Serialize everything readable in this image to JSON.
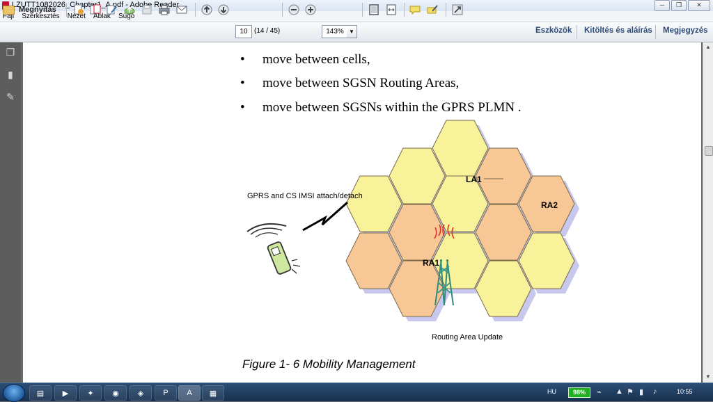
{
  "window": {
    "title": "LZUTT1082026_Chapter1_A.pdf - Adobe Reader",
    "controls": [
      "minimize",
      "restore",
      "close"
    ]
  },
  "menubar": {
    "items": [
      "Fájl",
      "Szerkesztés",
      "Nézet",
      "Ablak",
      "Súgó"
    ]
  },
  "toolbar": {
    "open_label": "Megnyitás",
    "page_number": "10",
    "page_count": "(14 / 45)",
    "zoom": "143%",
    "right_links": [
      "Eszközök",
      "Kitöltés és aláírás",
      "Megjegyzés"
    ]
  },
  "document": {
    "bullets": [
      "move between cells,",
      "move between SGSN Routing Areas,",
      "move between SGSNs within the GPRS PLMN ."
    ],
    "figure": {
      "attach_label": "GPRS and CS IMSI attach/detach",
      "la_label": "LA1",
      "ra1_label": "RA1",
      "ra2_label": "RA2",
      "update_label": "Routing Area Update",
      "caption": "Figure 1- 6 Mobility Management"
    },
    "colors": {
      "yellow_cell": "#f8f39a",
      "orange_cell": "#f7c795",
      "shadow": "#c8c8ee"
    }
  },
  "taskbar": {
    "language": "HU",
    "battery": "98%",
    "clock": "10:55",
    "pinned": [
      "explorer-icon",
      "media-player-icon",
      "app-icon",
      "chrome-icon",
      "vpn-icon",
      "powerpoint-icon",
      "adobe-reader-icon",
      "notepad-icon"
    ]
  }
}
